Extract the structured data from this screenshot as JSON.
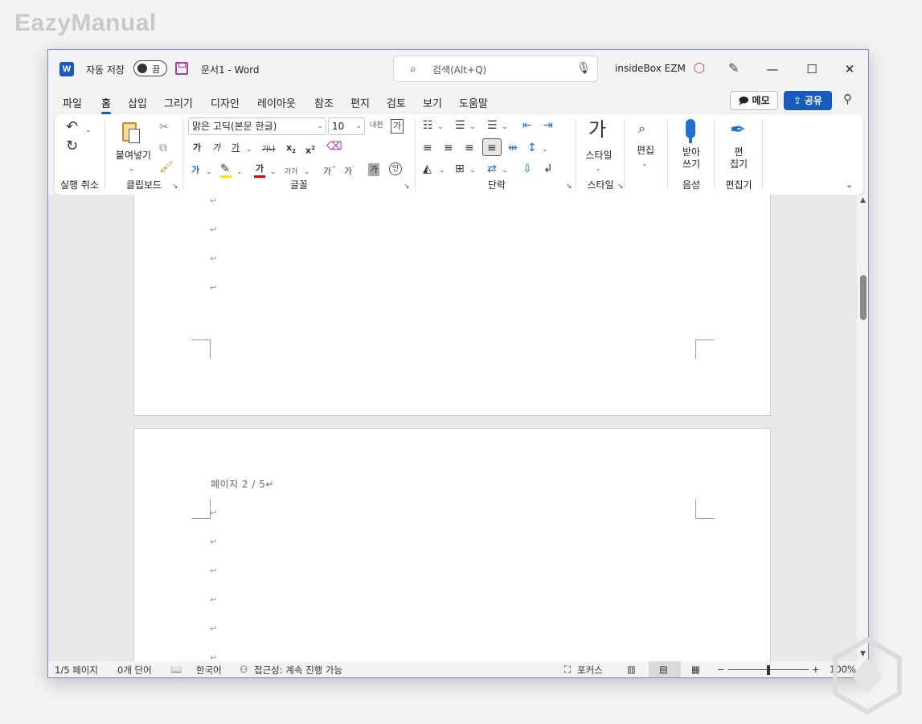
{
  "watermark": "EazyManual",
  "titlebar": {
    "app_icon": "W",
    "autosave_label": "자동 저장",
    "autosave_state": "끔",
    "doc_title": "문서1  -  Word",
    "search_placeholder": "검색(Alt+Q)",
    "user_name": "insideBox EZM",
    "controls": {
      "minimize": "—",
      "maximize": "☐",
      "close": "✕"
    }
  },
  "menu": {
    "items": [
      "파일",
      "홈",
      "삽입",
      "그리기",
      "디자인",
      "레이아웃",
      "참조",
      "편지",
      "검토",
      "보기",
      "도움말"
    ],
    "active": "홈",
    "memo": "메모",
    "share": "공유"
  },
  "ribbon": {
    "undo_group": "실행 취소",
    "clipboard_group": "클립보드",
    "paste": "붙여넣기",
    "font_group": "글꼴",
    "font_name": "맑은 고딕(본문 한글)",
    "font_size": "10",
    "font_buttons": {
      "bold": "가",
      "italic": "가",
      "underline": "가",
      "strike": "가나",
      "subscript": "x",
      "superscript": "x",
      "font_color": "가",
      "case": "가가",
      "grow": "가",
      "shrink": "가",
      "shade": "가",
      "enclose": "인",
      "phonetic": "내천",
      "border": "가",
      "highlight_color": "#ffe600",
      "font_color_value": "#e00000"
    },
    "paragraph_group": "단락",
    "styles_group": "스타일",
    "styles_btn": "스타일",
    "edit_btn": "편집",
    "voice_group": "음성",
    "dictate_btn": [
      "받아",
      "쓰기"
    ],
    "editor_group": "편집기",
    "editor_btn": [
      "편",
      "집기"
    ]
  },
  "document": {
    "para_mark": "↵",
    "page2_label": "페이지 2 / 5↵"
  },
  "statusbar": {
    "page": "1/5 페이지",
    "words": "0개 단어",
    "language": "한국어",
    "accessibility": "접근성: 계속 진행 가능",
    "focus": "포커스",
    "zoom": "100%",
    "zoom_minus": "−",
    "zoom_plus": "+"
  }
}
